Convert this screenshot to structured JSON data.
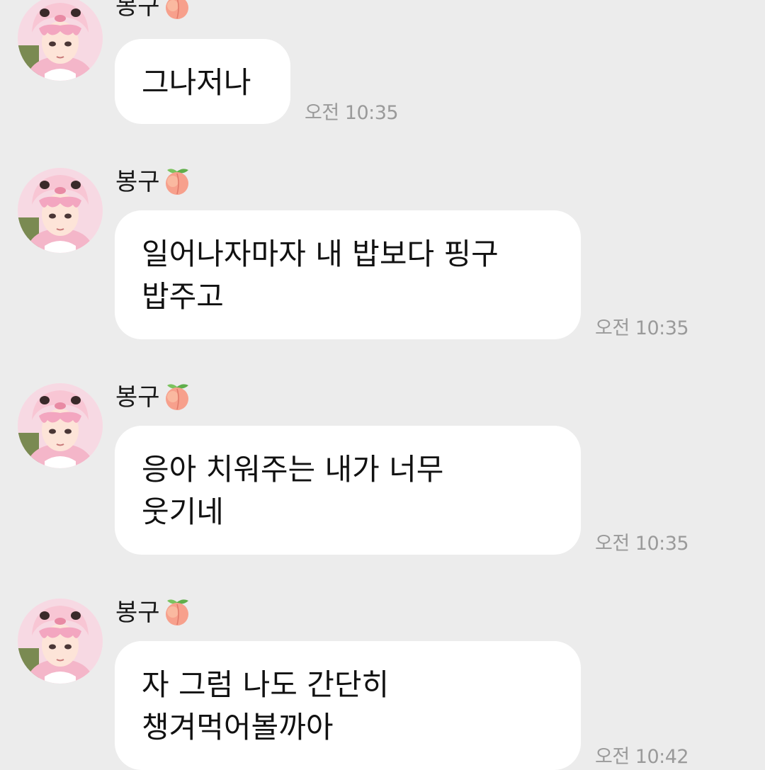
{
  "messages": [
    {
      "sender": "봉구",
      "sender_emoji": "peach-icon",
      "text": "그나저나",
      "time": "오전 10:35"
    },
    {
      "sender": "봉구",
      "sender_emoji": "peach-icon",
      "text": "일어나자마자 내 밥보다 핑구\n밥주고",
      "time": "오전 10:35"
    },
    {
      "sender": "봉구",
      "sender_emoji": "peach-icon",
      "text": "응아 치워주는 내가 너무\n웃기네",
      "time": "오전 10:35"
    },
    {
      "sender": "봉구",
      "sender_emoji": "peach-icon",
      "text": "자 그럼 나도 간단히\n챙겨먹어볼까아",
      "time": "오전 10:42"
    }
  ],
  "colors": {
    "background": "#ececec",
    "bubble": "#ffffff",
    "time_text": "#9a9a9a",
    "avatar_hair": "#f3a6c0",
    "peach": "#f7a08c"
  }
}
